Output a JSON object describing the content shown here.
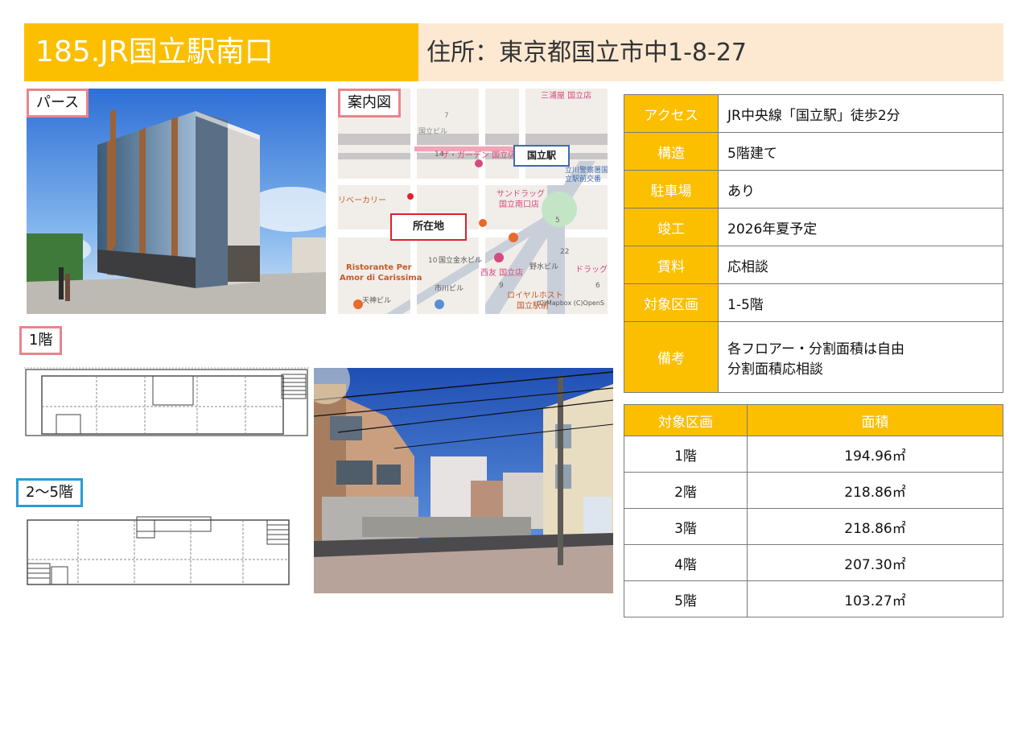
{
  "header": {
    "title": "185.JR国立駅南口",
    "address": "住所：東京都国立市中1-8-27"
  },
  "labels": {
    "perspective": "パース",
    "map": "案内図",
    "floor1": "1階",
    "floor2_5": "2〜5階"
  },
  "map": {
    "station_label": "国立駅",
    "location_label": "所在地",
    "place_names": [
      "三浦屋 国立店",
      "国立ビル",
      "ザ・ガーデン 国立店",
      "立川警察署国立駅前交番",
      "サンドラッグ 国立南口店",
      "リベーカリー",
      "Ristorante Per",
      "Amor di Carissima",
      "国立金水ビル",
      "野水ビル",
      "西友 国立店",
      "ドラッグ・",
      "市川ビル",
      "天神ビル",
      "ロイヤルホスト 国立駅前",
      "(C)Mapbox (C)OpenS"
    ],
    "numbers": [
      "7",
      "5",
      "10",
      "22",
      "6",
      "9",
      "14"
    ]
  },
  "info_table": [
    {
      "label": "アクセス",
      "value": "JR中央線「国立駅」徒歩2分"
    },
    {
      "label": "構造",
      "value": "5階建て"
    },
    {
      "label": "駐車場",
      "value": "あり"
    },
    {
      "label": "竣工",
      "value": "2026年夏予定"
    },
    {
      "label": "賃料",
      "value": "応相談"
    },
    {
      "label": "対象区画",
      "value": "1-5階"
    },
    {
      "label": "備考",
      "value": "各フロアー・分割面積は自由",
      "value2": "分割面積応相談"
    }
  ],
  "area_table": {
    "headers": [
      "対象区画",
      "面積"
    ],
    "rows": [
      {
        "floor": "1階",
        "area": "194.96㎡"
      },
      {
        "floor": "2階",
        "area": "218.86㎡"
      },
      {
        "floor": "3階",
        "area": "218.86㎡"
      },
      {
        "floor": "4階",
        "area": "207.30㎡"
      },
      {
        "floor": "5階",
        "area": "103.27㎡"
      }
    ]
  },
  "colors": {
    "accent": "#fbbf00",
    "address_bg": "#fde8d2",
    "tag_border": "#e9848d",
    "tag_border_blue": "#2a9bd8",
    "map_marker": "#e0202d"
  }
}
